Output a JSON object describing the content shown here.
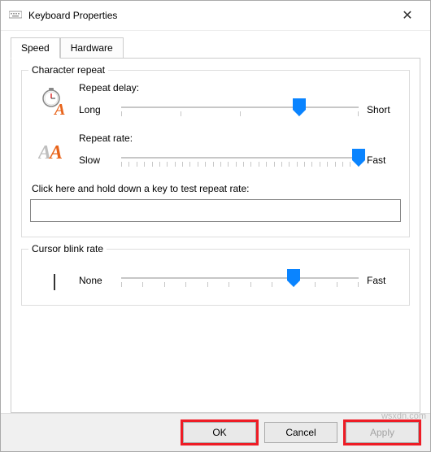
{
  "window": {
    "title": "Keyboard Properties"
  },
  "tabs": [
    "Speed",
    "Hardware"
  ],
  "active_tab": 0,
  "character_repeat": {
    "group_label": "Character repeat",
    "delay": {
      "label": "Repeat delay:",
      "left": "Long",
      "right": "Short",
      "value": 3,
      "max": 4
    },
    "rate": {
      "label": "Repeat rate:",
      "left": "Slow",
      "right": "Fast",
      "value": 31,
      "max": 31
    },
    "test_label": "Click here and hold down a key to test repeat rate:",
    "test_value": ""
  },
  "cursor_blink": {
    "group_label": "Cursor blink rate",
    "left": "None",
    "right": "Fast",
    "value": 8,
    "max": 11
  },
  "buttons": {
    "ok": "OK",
    "cancel": "Cancel",
    "apply": "Apply"
  },
  "watermark": "wsxdn.com"
}
